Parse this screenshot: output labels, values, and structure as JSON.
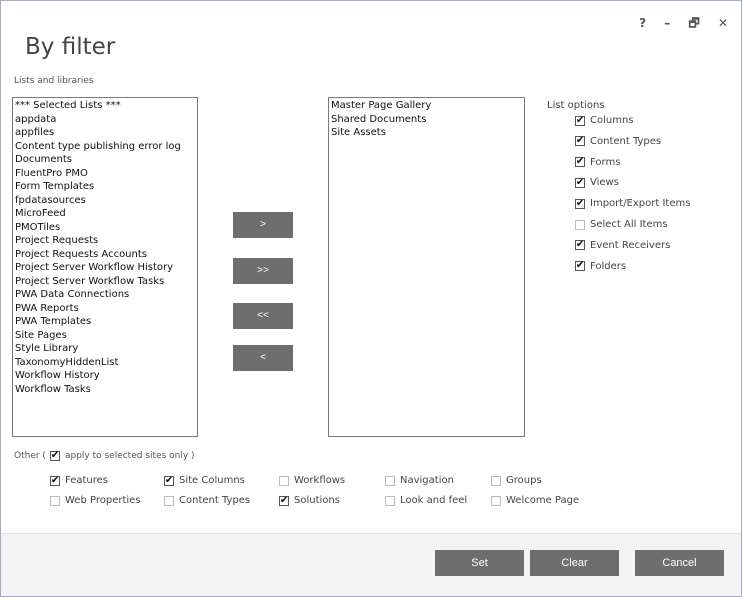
{
  "window": {
    "help": "?",
    "minimize": "–",
    "restore": "🗗",
    "close": "✕"
  },
  "title": "By filter",
  "lists_label": "Lists and libraries",
  "left_list": [
    "*** Selected Lists ***",
    "appdata",
    "appfiles",
    "Content type publishing error log",
    "Documents",
    "FluentPro PMO",
    "Form Templates",
    "fpdatasources",
    "MicroFeed",
    "PMOTiles",
    "Project Requests",
    "Project Requests Accounts",
    "Project Server Workflow History",
    "Project Server Workflow Tasks",
    "PWA Data Connections",
    "PWA Reports",
    "PWA Templates",
    "Site Pages",
    "Style Library",
    "TaxonomyHiddenList",
    "Workflow History",
    "Workflow Tasks"
  ],
  "right_list": [
    "Master Page Gallery",
    "Shared Documents",
    "Site Assets"
  ],
  "move_buttons": {
    "add": ">",
    "add_all": ">>",
    "remove_all": "<<",
    "remove": "<"
  },
  "list_options": {
    "label": "List options",
    "items": [
      {
        "label": "Columns",
        "checked": true
      },
      {
        "label": "Content Types",
        "checked": true
      },
      {
        "label": "Forms",
        "checked": true
      },
      {
        "label": "Views",
        "checked": true
      },
      {
        "label": "Import/Export Items",
        "checked": true
      },
      {
        "label": "Select All Items",
        "checked": false
      },
      {
        "label": "Event Receivers",
        "checked": true
      },
      {
        "label": "Folders",
        "checked": true
      }
    ]
  },
  "other": {
    "prefix": "Other (",
    "apply_label": "apply to selected sites only )",
    "apply_checked": true
  },
  "other_options": [
    {
      "label": "Features",
      "checked": true
    },
    {
      "label": "Site Columns",
      "checked": true
    },
    {
      "label": "Workflows",
      "checked": false
    },
    {
      "label": "Navigation",
      "checked": false
    },
    {
      "label": "Groups",
      "checked": false
    },
    {
      "label": "Web Properties",
      "checked": false
    },
    {
      "label": "Content Types",
      "checked": false
    },
    {
      "label": "Solutions",
      "checked": true
    },
    {
      "label": "Look and feel",
      "checked": false
    },
    {
      "label": "Welcome Page",
      "checked": false
    }
  ],
  "footer": {
    "set": "Set",
    "clear": "Clear",
    "cancel": "Cancel"
  },
  "colors": {
    "button_bg": "#6e6e6e",
    "border": "#a9a9c8"
  }
}
